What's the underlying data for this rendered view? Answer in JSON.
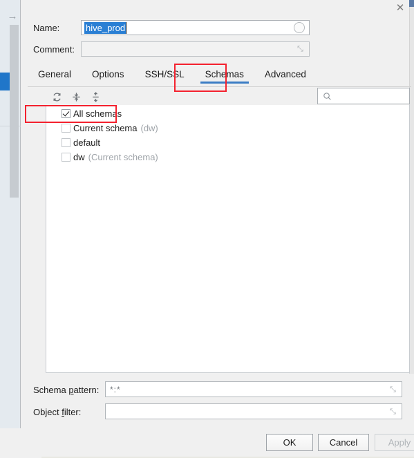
{
  "window": {
    "close_label": "✕",
    "left_arrow": "→"
  },
  "form": {
    "name_label": "Name:",
    "name_value": "hive_prod",
    "comment_label": "Comment:",
    "comment_value": "",
    "color_icon": "circle-icon",
    "expand_icon": "⤡"
  },
  "tabs": [
    {
      "label": "General",
      "active": false
    },
    {
      "label": "Options",
      "active": false
    },
    {
      "label": "SSH/SSL",
      "active": false
    },
    {
      "label": "Schemas",
      "active": true
    },
    {
      "label": "Advanced",
      "active": false
    }
  ],
  "toolbar": {
    "refresh_icon": "↻",
    "expand_all_icon": "expand-all-icon",
    "collapse_all_icon": "collapse-all-icon"
  },
  "search": {
    "value": "",
    "placeholder": "",
    "icon": "search-icon"
  },
  "tree": {
    "rows": [
      {
        "label": "All schemas",
        "note": "",
        "checked": true,
        "dim": false
      },
      {
        "label": "Current schema",
        "note": "(dw)",
        "checked": false,
        "dim": true
      },
      {
        "label": "default",
        "note": "",
        "checked": false,
        "dim": true
      },
      {
        "label": "dw",
        "note": "(Current schema)",
        "checked": false,
        "dim": true
      }
    ]
  },
  "bottom": {
    "schema_pattern_label_pre": "Schema ",
    "schema_pattern_label_mn": "p",
    "schema_pattern_label_post": "attern:",
    "schema_pattern_value": "*:*",
    "object_filter_label_pre": "Object ",
    "object_filter_label_mn": "f",
    "object_filter_label_post": "ilter:",
    "object_filter_value": ""
  },
  "footer": {
    "ok_label": "OK",
    "cancel_label": "Cancel",
    "apply_label": "Apply",
    "apply_enabled": false
  },
  "colors": {
    "accent_blue": "#3a7cc4",
    "selection_blue": "#2a7fd4",
    "annotation_red": "#f4212e",
    "left_panel": "#e4eaef"
  }
}
